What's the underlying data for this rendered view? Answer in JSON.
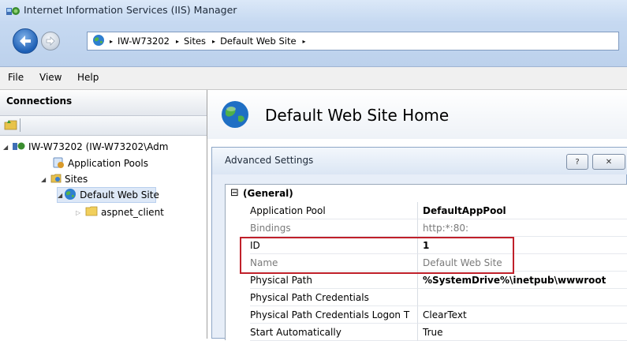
{
  "window": {
    "title": "Internet Information Services (IIS) Manager"
  },
  "address_bar": {
    "crumbs": [
      "IW-W73202",
      "Sites",
      "Default Web Site"
    ],
    "separator": "▸"
  },
  "menu": {
    "items": [
      "File",
      "View",
      "Help"
    ]
  },
  "connections": {
    "title": "Connections",
    "tree": {
      "server": "IW-W73202 (IW-W73202\\Adm",
      "app_pools": "Application Pools",
      "sites": "Sites",
      "default_site": "Default Web Site",
      "aspnet_client": "aspnet_client"
    }
  },
  "main": {
    "page_title": "Default Web Site Home"
  },
  "dialog": {
    "title": "Advanced Settings",
    "help_button": "?",
    "close_button": "✕",
    "section": "(General)",
    "section_toggle": "⊟",
    "rows": [
      {
        "name": "Application Pool",
        "value": "DefaultAppPool"
      },
      {
        "name": "Bindings",
        "value": "http:*:80:"
      },
      {
        "name": "ID",
        "value": "1"
      },
      {
        "name": "Name",
        "value": "Default Web Site"
      },
      {
        "name": "Physical Path",
        "value": "%SystemDrive%\\inetpub\\wwwroot"
      },
      {
        "name": "Physical Path Credentials",
        "value": ""
      },
      {
        "name": "Physical Path Credentials Logon T",
        "value": "ClearText"
      },
      {
        "name": "Start Automatically",
        "value": "True"
      }
    ]
  },
  "colors": {
    "highlight": "#c0202a",
    "titlebar": "#c6d9f1",
    "selection": "#dde8f7"
  }
}
